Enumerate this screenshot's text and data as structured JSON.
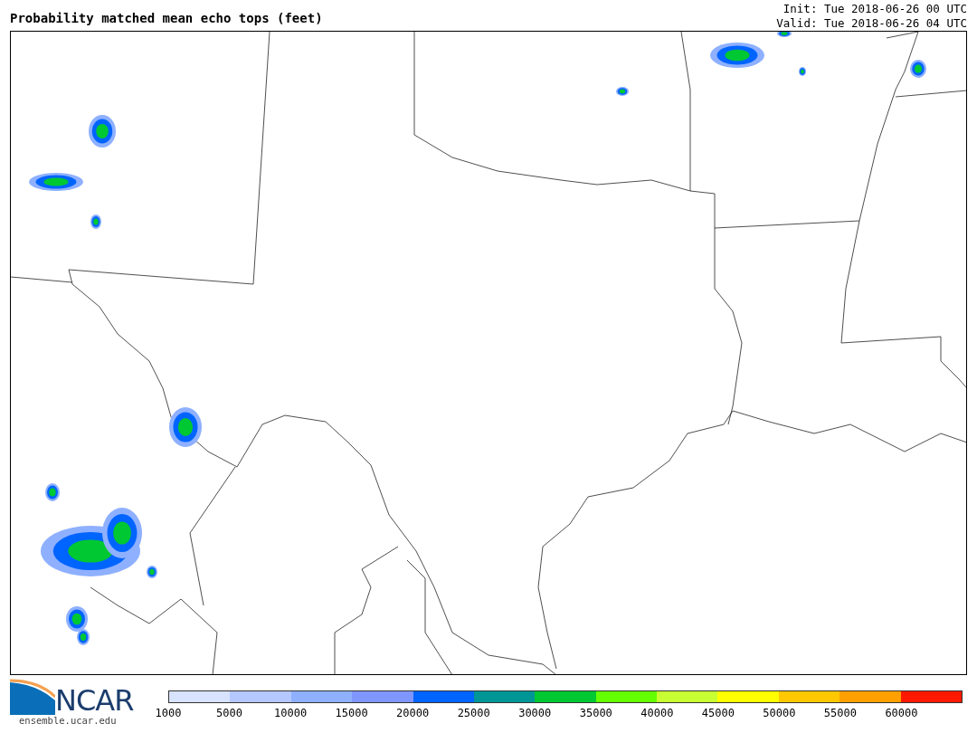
{
  "title": "Probability matched mean echo tops (feet)",
  "init": "Init: Tue 2018-06-26 00 UTC",
  "valid": "Valid: Tue 2018-06-26 04 UTC",
  "logo": {
    "text": "NCAR",
    "url": "ensemble.ucar.edu"
  },
  "legend": {
    "bins": [
      {
        "label": "1000",
        "color": "#d7e3ff"
      },
      {
        "label": "5000",
        "color": "#b4c8ff"
      },
      {
        "label": "10000",
        "color": "#8eb0ff"
      },
      {
        "label": "15000",
        "color": "#7f96ff"
      },
      {
        "label": "20000",
        "color": "#0064ff"
      },
      {
        "label": "25000",
        "color": "#009696"
      },
      {
        "label": "30000",
        "color": "#00c832"
      },
      {
        "label": "35000",
        "color": "#64ff00"
      },
      {
        "label": "40000",
        "color": "#c8ff32"
      },
      {
        "label": "45000",
        "color": "#ffff00"
      },
      {
        "label": "50000",
        "color": "#ffc800"
      },
      {
        "label": "55000",
        "color": "#ffa000"
      },
      {
        "label": "60000",
        "color": "#ff1900"
      }
    ]
  }
}
